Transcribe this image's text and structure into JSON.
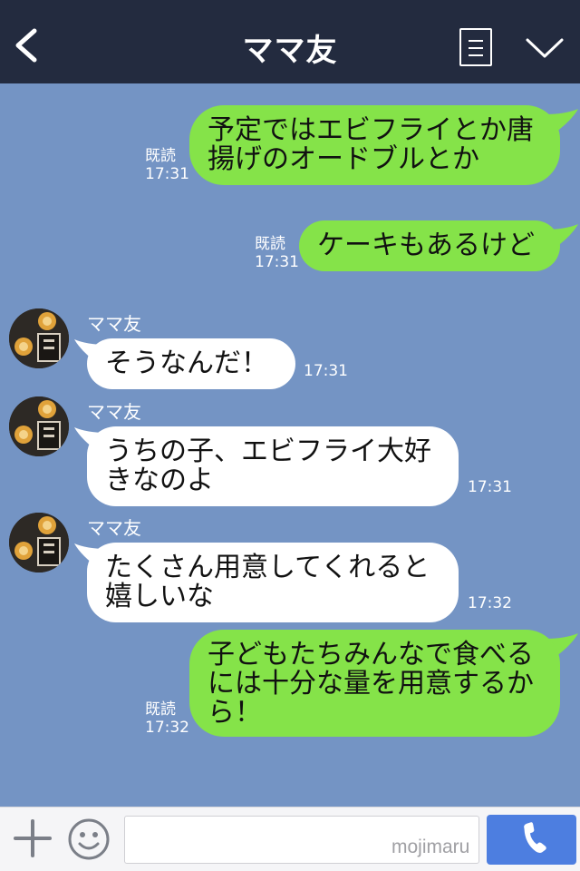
{
  "header": {
    "title": "ママ友",
    "back_icon": "chevron-left-icon",
    "menu_icon": "list-icon",
    "more_icon": "chevron-down-icon"
  },
  "messages": [
    {
      "side": "out",
      "text": "予定ではエビフライとか唐\n揚げのオードブルとか",
      "read": "既読",
      "time": "17:31"
    },
    {
      "side": "out",
      "text": "ケーキもあるけど",
      "read": "既読",
      "time": "17:31"
    },
    {
      "side": "in",
      "sender": "ママ友",
      "text": "そうなんだ！",
      "time": "17:31"
    },
    {
      "side": "in",
      "sender": "ママ友",
      "text": "うちの子、エビフライ大好\nきなのよ",
      "time": "17:31"
    },
    {
      "side": "in",
      "sender": "ママ友",
      "text": "たくさん用意してくれると\n嬉しいな",
      "time": "17:32"
    },
    {
      "side": "out",
      "text": "子どもたちみんなで食べる\nには十分な量を用意するか\nら！",
      "read": "既読",
      "time": "17:32"
    }
  ],
  "footer": {
    "input_value": "",
    "watermark": "mojimaru",
    "plus_icon": "plus-icon",
    "emoji_icon": "smiley-icon",
    "call_icon": "phone-icon"
  },
  "colors": {
    "background": "#7494c4",
    "header": "#232b3f",
    "outgoing_bubble": "#85e349",
    "incoming_bubble": "#ffffff",
    "call_button": "#4d7ee0"
  }
}
